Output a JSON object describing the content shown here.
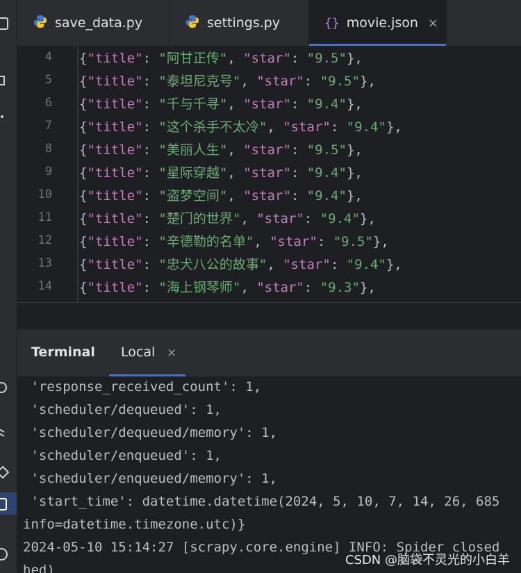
{
  "tabs": [
    {
      "label": "save_data.py",
      "icon": "python-icon"
    },
    {
      "label": "settings.py",
      "icon": "python-icon"
    },
    {
      "label": "movie.json",
      "icon": "json-braces-icon",
      "close": "×"
    }
  ],
  "editor": {
    "lines": [
      {
        "num": "4",
        "title": "\"阿甘正传\"",
        "star": "\"9.5\""
      },
      {
        "num": "5",
        "title": "\"泰坦尼克号\"",
        "star": "\"9.5\""
      },
      {
        "num": "6",
        "title": "\"千与千寻\"",
        "star": "\"9.4\""
      },
      {
        "num": "7",
        "title": "\"这个杀手不太冷\"",
        "star": "\"9.4\""
      },
      {
        "num": "8",
        "title": "\"美丽人生\"",
        "star": "\"9.5\""
      },
      {
        "num": "9",
        "title": "\"星际穿越\"",
        "star": "\"9.4\""
      },
      {
        "num": "10",
        "title": "\"盗梦空间\"",
        "star": "\"9.4\""
      },
      {
        "num": "11",
        "title": "\"楚门的世界\"",
        "star": "\"9.4\""
      },
      {
        "num": "12",
        "title": "\"辛德勒的名单\"",
        "star": "\"9.5\""
      },
      {
        "num": "13",
        "title": "\"忠犬八公的故事\"",
        "star": "\"9.4\""
      },
      {
        "num": "14",
        "title": "\"海上钢琴师\"",
        "star": "\"9.3\""
      }
    ],
    "key_title": "\"title\"",
    "key_star": "\"star\""
  },
  "terminal": {
    "title": "Terminal",
    "tab_label": "Local",
    "tab_close": "×",
    "lines": [
      " 'response_received_count': 1,",
      " 'scheduler/dequeued': 1,",
      " 'scheduler/dequeued/memory': 1,",
      " 'scheduler/enqueued': 1,",
      " 'scheduler/enqueued/memory': 1,",
      " 'start_time': datetime.datetime(2024, 5, 10, 7, 14, 26, 685",
      "info=datetime.timezone.utc)}",
      "2024-05-10 15:14:27 [scrapy.core.engine] INFO: Spider closed",
      "hed)"
    ]
  },
  "watermark": "CSDN @脑袋不灵光的小白羊",
  "colors": {
    "accent": "#3574f0",
    "string": "#6aab73",
    "key": "#c77dbb",
    "background": "#1e1f22",
    "panel": "#2b2d30"
  }
}
